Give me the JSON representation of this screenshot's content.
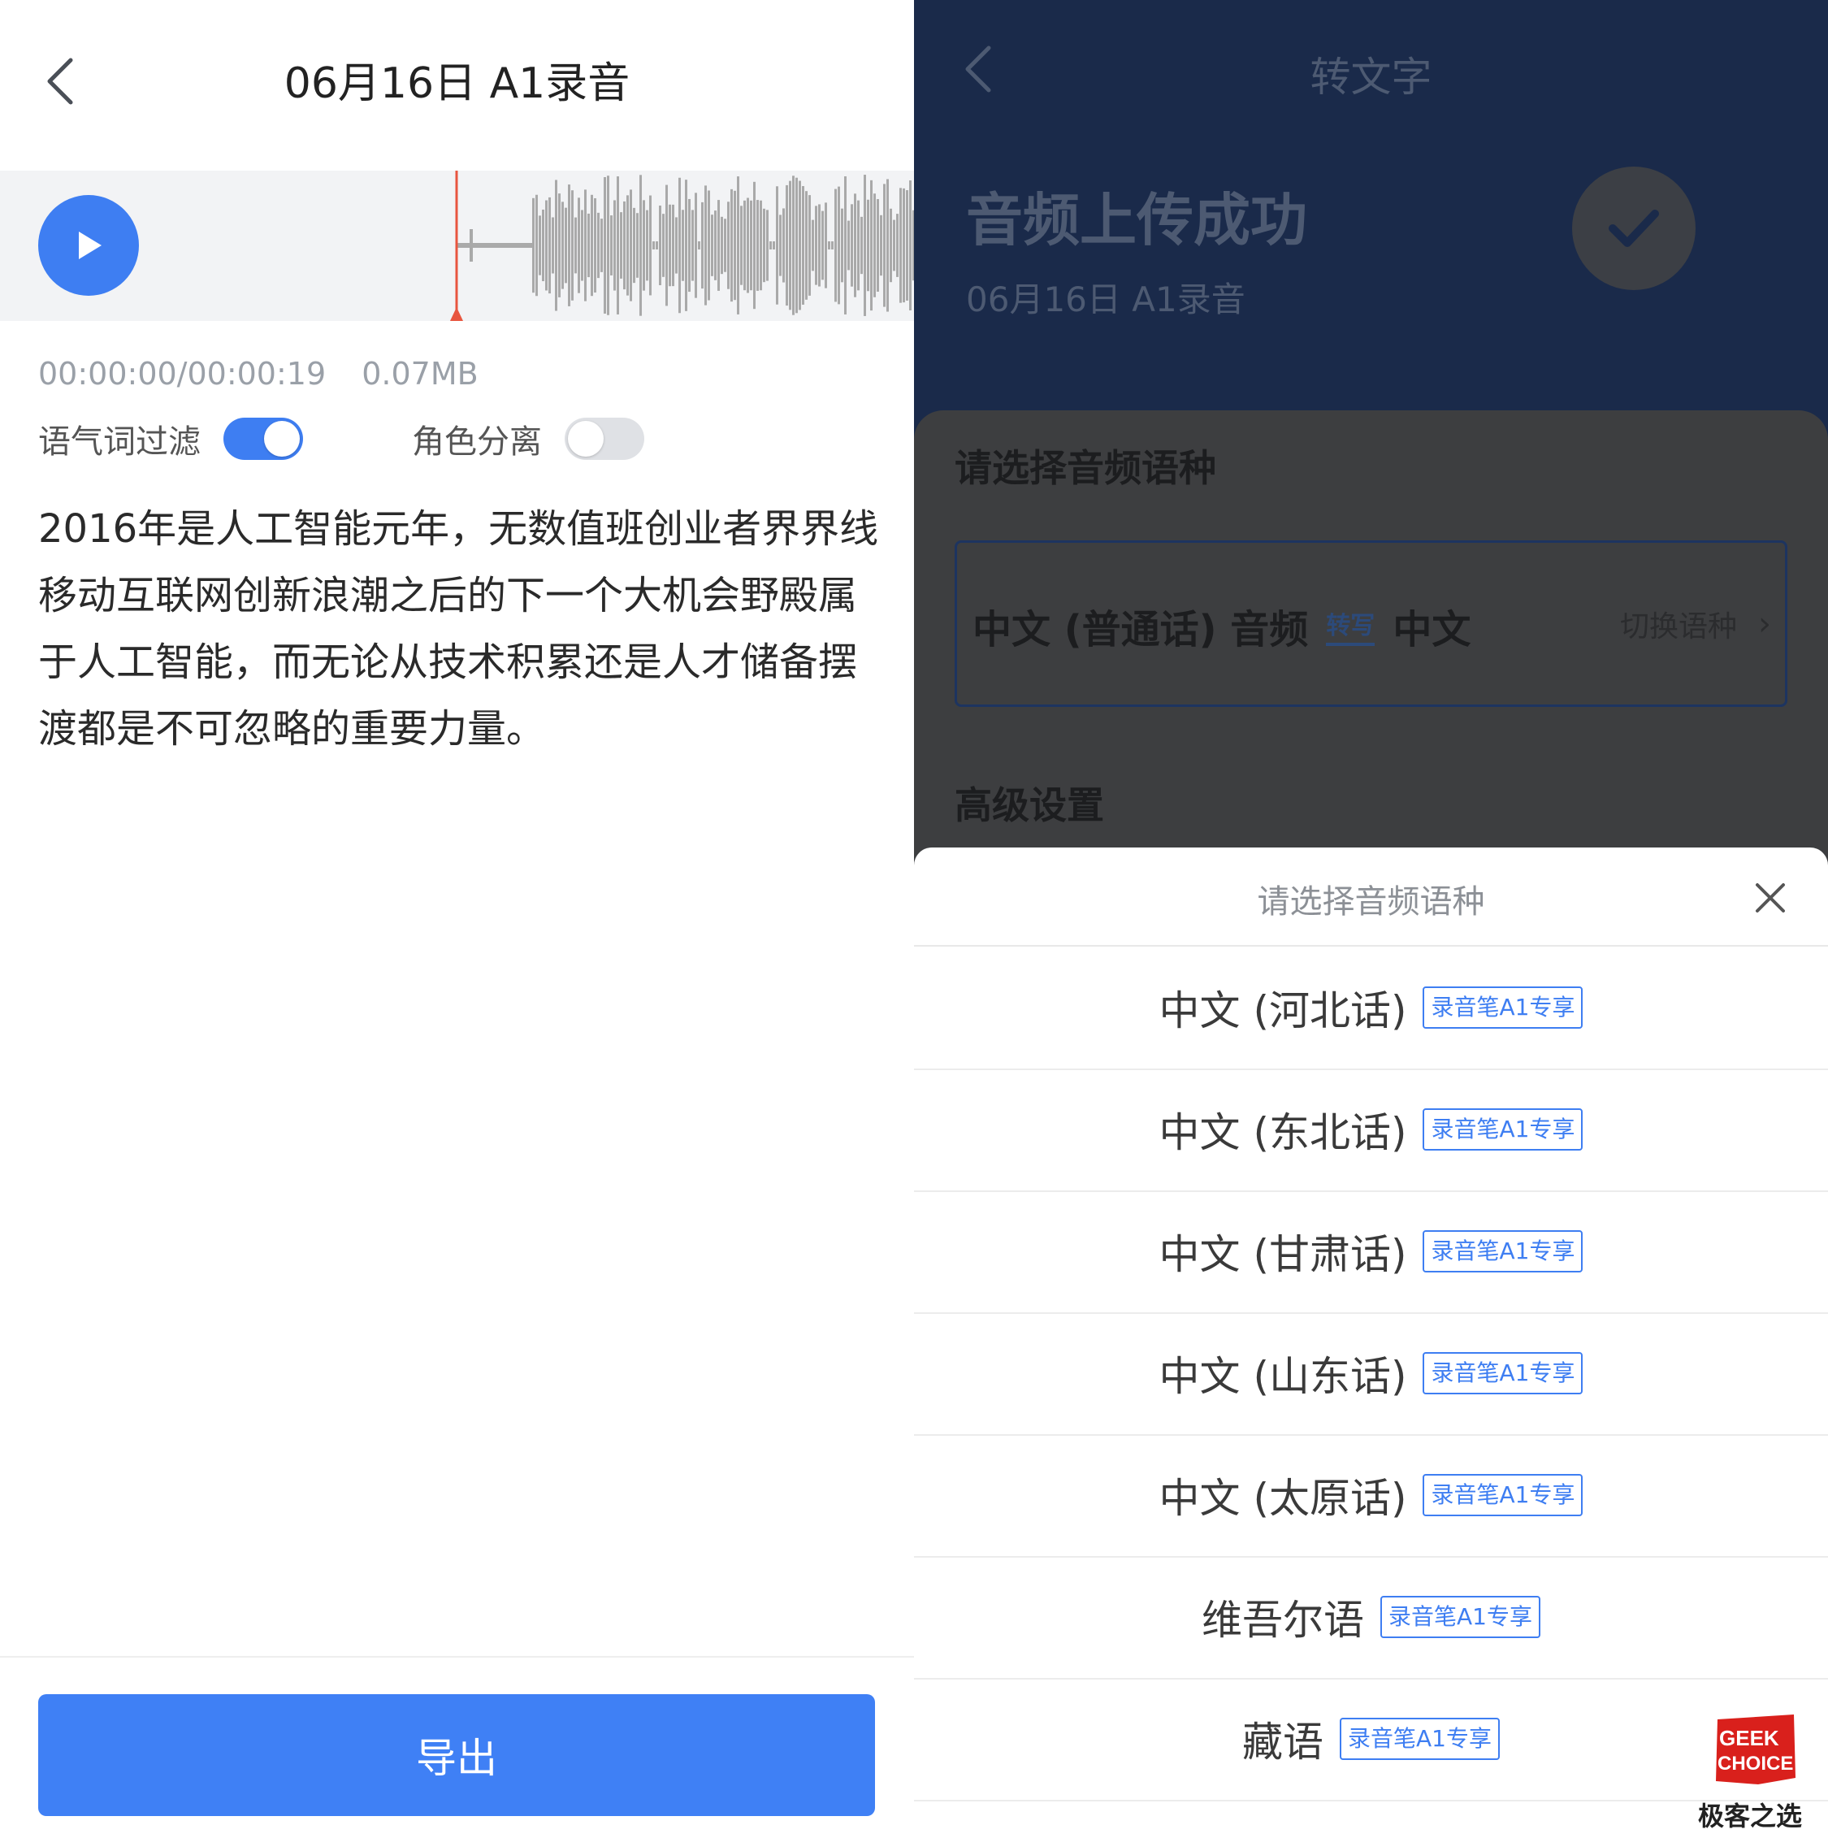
{
  "left": {
    "title": "06月16日 A1录音",
    "time_readout": "00:00:00/00:00:19",
    "file_size": "0.07MB",
    "toggles": [
      {
        "label": "语气词过滤",
        "state": "on"
      },
      {
        "label": "角色分离",
        "state": "off"
      }
    ],
    "transcript": "2016年是人工智能元年，无数值班创业者界界线移动互联网创新浪潮之后的下一个大机会野殿属于人工智能，而无论从技术积累还是人才储备摆渡都是不可忽略的重要力量。",
    "export_label": "导出",
    "accent_color": "#3e7ef2",
    "playhead_color": "#e8553f"
  },
  "right": {
    "nav_title": "转文字",
    "upload_heading": "音频上传成功",
    "upload_sub": "06月16日 A1录音",
    "section_language": "请选择音频语种",
    "language_source": "中文 (普通话) 音频",
    "language_arrow": "转写",
    "language_target": "中文",
    "switch_label": "切换语种",
    "section_advanced": "高级设置",
    "sheet": {
      "title": "请选择音频语种",
      "options": [
        {
          "label": "中文 (河北话)",
          "badge": "录音笔A1专享"
        },
        {
          "label": "中文 (东北话)",
          "badge": "录音笔A1专享"
        },
        {
          "label": "中文 (甘肃话)",
          "badge": "录音笔A1专享"
        },
        {
          "label": "中文 (山东话)",
          "badge": "录音笔A1专享"
        },
        {
          "label": "中文 (太原话)",
          "badge": "录音笔A1专享"
        },
        {
          "label": "维吾尔语",
          "badge": "录音笔A1专享"
        },
        {
          "label": "藏语",
          "badge": "录音笔A1专享"
        }
      ]
    }
  },
  "watermark": {
    "logo_line1": "GEEK",
    "logo_line2": "CHOICE",
    "caption": "极客之选",
    "color": "#d9201c"
  }
}
